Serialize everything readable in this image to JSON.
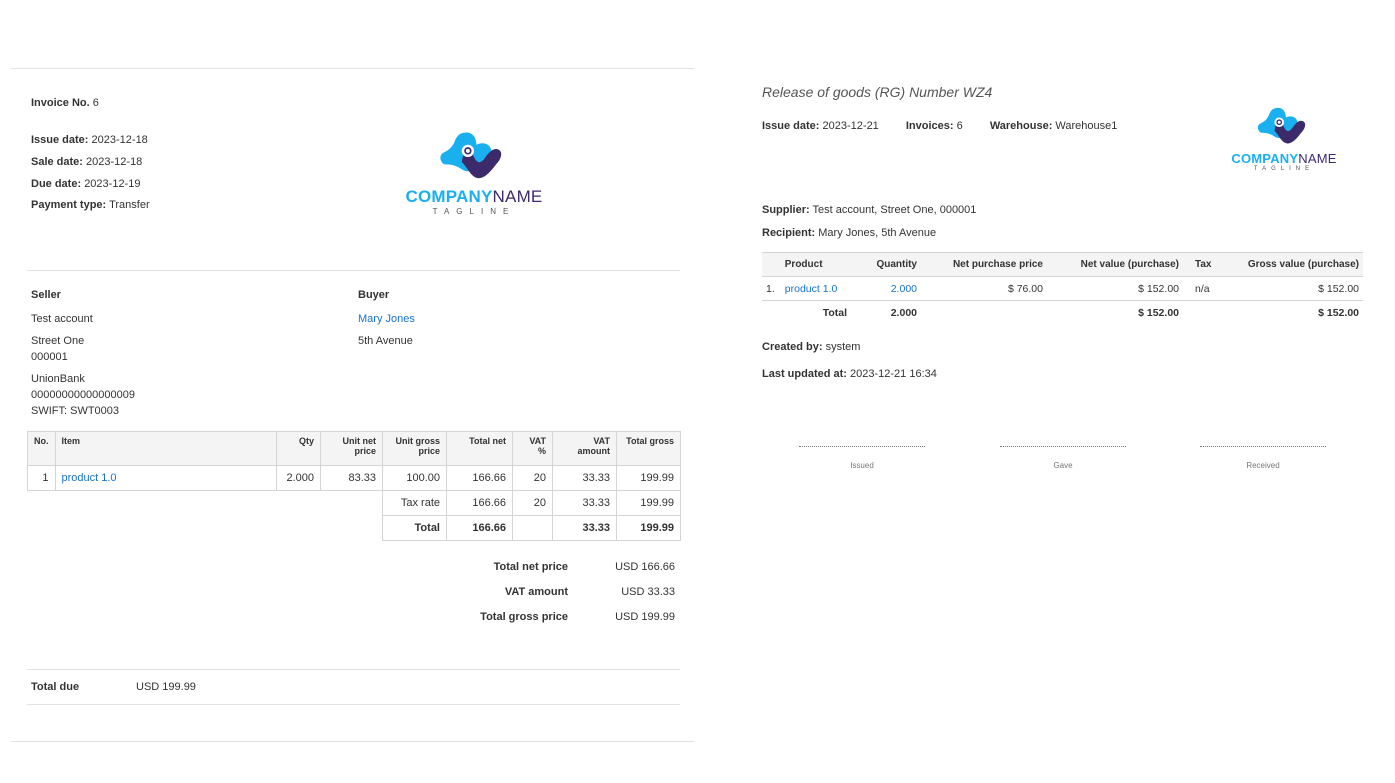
{
  "invoice": {
    "title_label": "Invoice No.",
    "number": "6",
    "issue_label": "Issue date:",
    "issue": "2023-12-18",
    "sale_label": "Sale date:",
    "sale": "2023-12-18",
    "due_label": "Due date:",
    "due": "2023-12-19",
    "payment_label": "Payment type:",
    "payment": "Transfer",
    "seller": {
      "heading": "Seller",
      "name": "Test account",
      "street": "Street One",
      "zip": "000001",
      "bank": "UnionBank",
      "account": "00000000000000009",
      "swift": "SWIFT: SWT0003"
    },
    "buyer": {
      "heading": "Buyer",
      "name": "Mary Jones",
      "street": "5th Avenue"
    },
    "table": {
      "headers": [
        "No.",
        "Item",
        "Qty",
        "Unit net price",
        "Unit gross price",
        "Total net",
        "VAT %",
        "VAT amount",
        "Total gross"
      ],
      "row": [
        "1",
        "product 1.0",
        "2.000",
        "83.33",
        "100.00",
        "166.66",
        "20",
        "33.33",
        "199.99"
      ],
      "tax_rate": [
        "Tax rate",
        "166.66",
        "20",
        "33.33",
        "199.99"
      ],
      "total": [
        "Total",
        "166.66",
        "",
        "33.33",
        "199.99"
      ]
    },
    "summary": [
      {
        "label": "Total net price",
        "value": "USD 166.66"
      },
      {
        "label": "VAT amount",
        "value": "USD 33.33"
      },
      {
        "label": "Total gross price",
        "value": "USD 199.99"
      }
    ],
    "total_due_label": "Total due",
    "total_due": "USD 199.99"
  },
  "logo": {
    "company": "COMPANY",
    "name": "NAME",
    "tagline": "TAGLINE",
    "colors": {
      "blue": "#1ab0f0",
      "purple": "#3d2a6b"
    }
  },
  "release": {
    "title": "Release of goods (RG) Number WZ4",
    "issue_label": "Issue date:",
    "issue": "2023-12-21",
    "invoices_label": "Invoices:",
    "invoices": "6",
    "warehouse_label": "Warehouse:",
    "warehouse": "Warehouse1",
    "supplier_label": "Supplier:",
    "supplier": "Test account, Street One, 000001",
    "recipient_label": "Recipient:",
    "recipient": "Mary Jones, 5th Avenue",
    "table": {
      "headers": [
        "Product",
        "Quantity",
        "Net purchase price",
        "Net value (purchase)",
        "Tax",
        "Gross value (purchase)"
      ],
      "row": {
        "no": "1.",
        "product": "product 1.0",
        "qty": "2.000",
        "price": "$ 76.00",
        "net": "$ 152.00",
        "tax": "n/a",
        "gross": "$ 152.00"
      },
      "total": {
        "label": "Total",
        "qty": "2.000",
        "net": "$ 152.00",
        "gross": "$ 152.00"
      }
    },
    "created_label": "Created by:",
    "created": "system",
    "updated_label": "Last updated at:",
    "updated": "2023-12-21 16:34",
    "signatures": [
      "Issued",
      "Gave",
      "Received"
    ]
  }
}
